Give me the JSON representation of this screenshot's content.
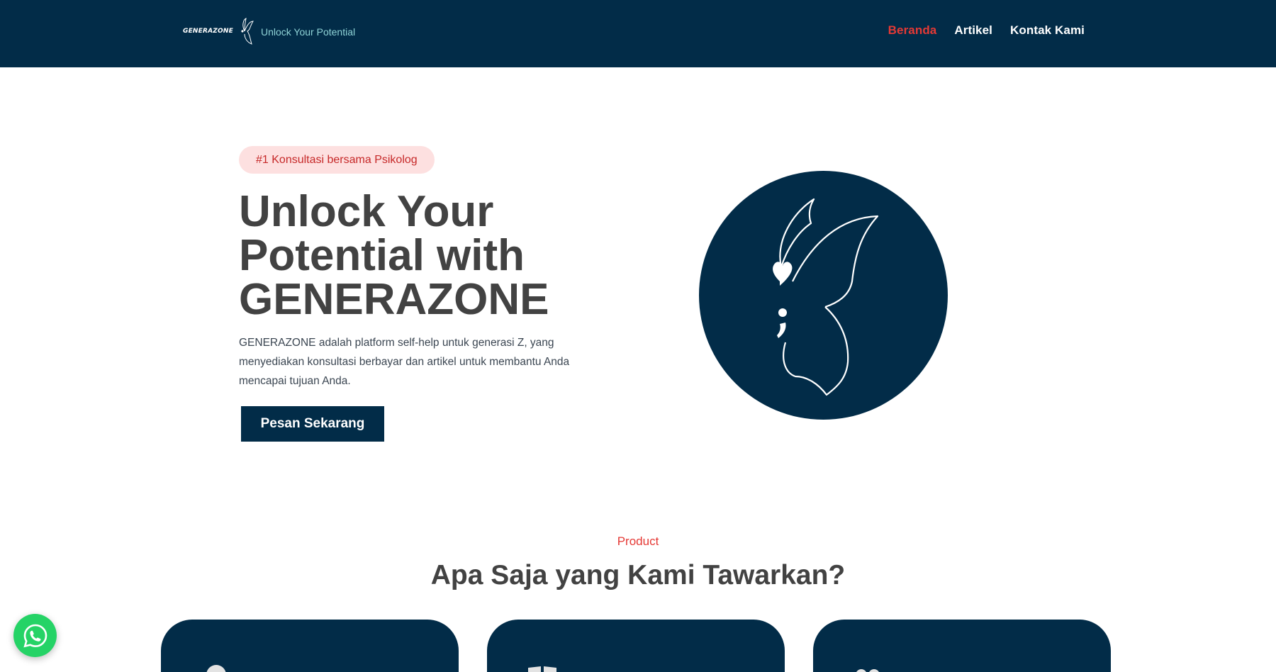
{
  "navbar": {
    "brand_name": "GENERAZONE",
    "tagline": "Unlock Your Potential",
    "links": [
      {
        "label": "Beranda",
        "active": true
      },
      {
        "label": "Artikel",
        "active": false
      },
      {
        "label": "Kontak Kami",
        "active": false
      }
    ]
  },
  "hero": {
    "badge": "#1 Konsultasi bersama Psikolog",
    "title": "Unlock Your Potential with GENERAZONE",
    "description": "GENERAZONE adalah platform self-help untuk generasi Z, yang menyediakan konsultasi berbayar dan artikel untuk membantu Anda mencapai tujuan Anda.",
    "cta_label": "Pesan Sekarang",
    "illustration_icon": "butterfly-heart-semicolon-icon"
  },
  "products": {
    "eyebrow": "Product",
    "title": "Apa Saja yang Kami Tawarkan?",
    "cards": [
      {
        "icon": "user-icon"
      },
      {
        "icon": "book-open-icon"
      },
      {
        "icon": "users-icon"
      }
    ]
  },
  "floating": {
    "whatsapp_icon": "whatsapp-icon"
  },
  "colors": {
    "navy": "#022c48",
    "accent_red": "#e53935",
    "badge_bg": "#fde0e0",
    "tagline_teal": "#8fd3d6",
    "whatsapp_green": "#25d366"
  }
}
